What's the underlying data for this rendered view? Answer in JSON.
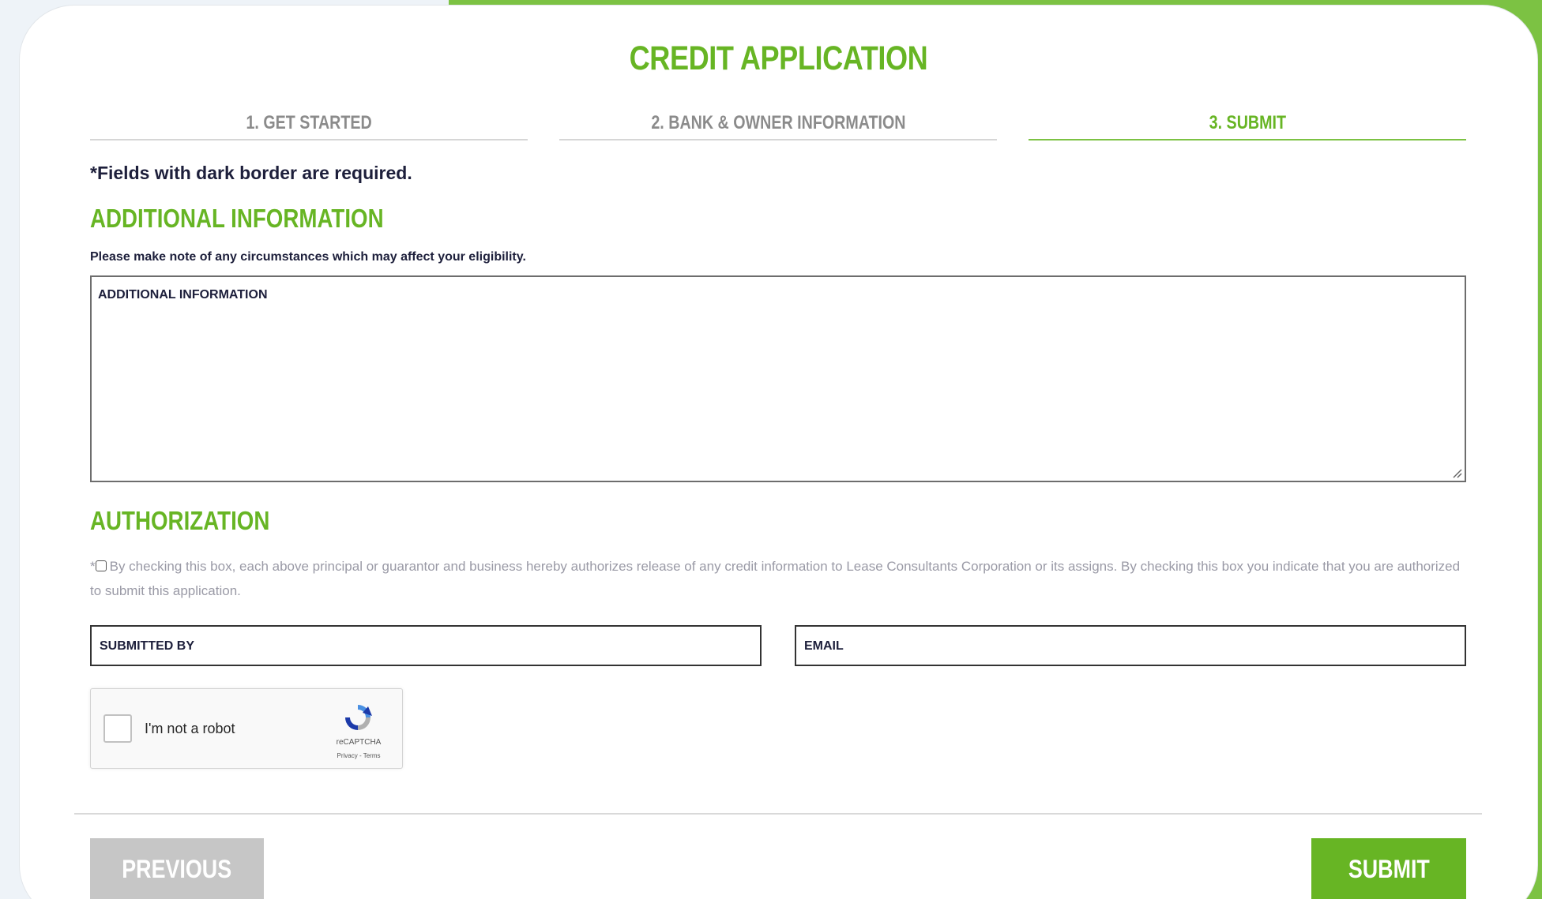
{
  "form": {
    "title": "CREDIT APPLICATION",
    "steps": [
      {
        "label": "1. GET STARTED",
        "active": false
      },
      {
        "label": "2. BANK & OWNER INFORMATION",
        "active": false
      },
      {
        "label": "3. SUBMIT",
        "active": true
      }
    ],
    "required_note": "*Fields with dark border are required."
  },
  "additional_info": {
    "heading": "ADDITIONAL INFORMATION",
    "helper": "Please make note of any circumstances which may affect your eligibility.",
    "textarea_placeholder": "ADDITIONAL INFORMATION"
  },
  "authorization": {
    "heading": "AUTHORIZATION",
    "required_marker": "*",
    "text": "By checking this box, each above principal or guarantor and business hereby authorizes release of any credit information to Lease Consultants Corporation or its assigns. By checking this box you indicate that you are authorized to submit this application.",
    "submitted_by_placeholder": "SUBMITTED BY",
    "email_placeholder": "EMAIL"
  },
  "recaptcha": {
    "label": "I'm not a robot",
    "brand": "reCAPTCHA",
    "terms": "Privacy - Terms"
  },
  "buttons": {
    "previous": "PREVIOUS",
    "submit": "SUBMIT"
  },
  "colors": {
    "accent_green": "#67b524",
    "bar_green": "#7cc243",
    "previous_gray": "#c6c6c6"
  }
}
